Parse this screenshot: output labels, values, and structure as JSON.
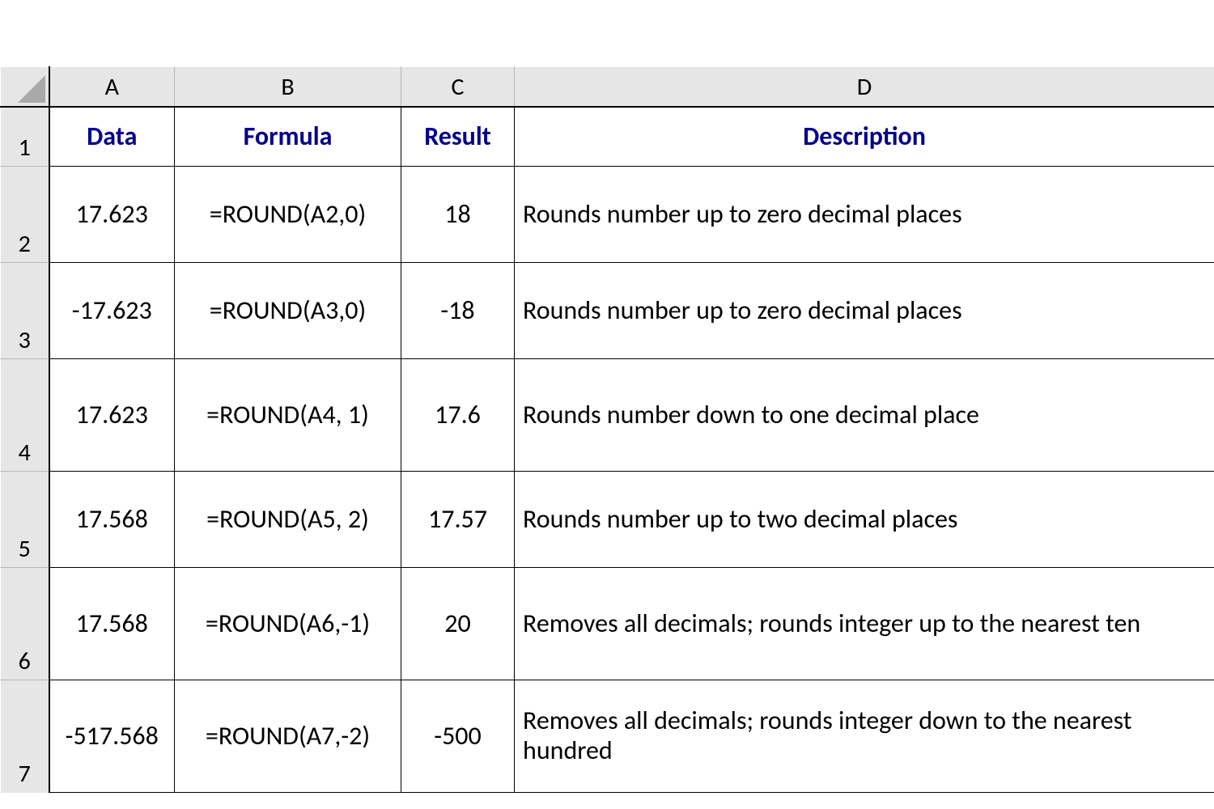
{
  "columns": {
    "A": "A",
    "B": "B",
    "C": "C",
    "D": "D"
  },
  "rowNumbers": {
    "r1": "1",
    "r2": "2",
    "r3": "3",
    "r4": "4",
    "r5": "5",
    "r6": "6",
    "r7": "7"
  },
  "header": {
    "data": "Data",
    "formula": "Formula",
    "result": "Result",
    "description": "Description"
  },
  "rows": [
    {
      "data": "17.623",
      "formula": "=ROUND(A2,0)",
      "result": "18",
      "description": "Rounds number up to zero decimal places"
    },
    {
      "data": "-17.623",
      "formula": "=ROUND(A3,0)",
      "result": "-18",
      "description": "Rounds number up to zero decimal places"
    },
    {
      "data": "17.623",
      "formula": "=ROUND(A4, 1)",
      "result": "17.6",
      "description": "Rounds number down to one decimal place"
    },
    {
      "data": "17.568",
      "formula": "=ROUND(A5, 2)",
      "result": "17.57",
      "description": "Rounds number up to two decimal places"
    },
    {
      "data": "17.568",
      "formula": "=ROUND(A6,-1)",
      "result": "20",
      "description": "Removes all decimals; rounds integer up to the nearest ten"
    },
    {
      "data": "-517.568",
      "formula": "=ROUND(A7,-2)",
      "result": "-500",
      "description": "Removes all decimals; rounds integer down to the nearest hundred"
    }
  ]
}
